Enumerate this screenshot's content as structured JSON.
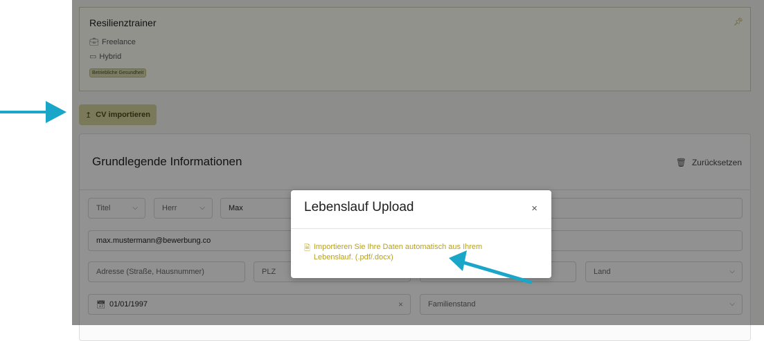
{
  "job": {
    "title": "Resilienztrainer",
    "employment_type": "Freelance",
    "work_mode": "Hybrid",
    "tag": "Betriebliche Gesundheit"
  },
  "cv_button": {
    "label": "CV importieren"
  },
  "form": {
    "title": "Grundlegende Informationen",
    "reset_label": "Zurücksetzen",
    "title_select": "Titel",
    "salutation_select": "Herr",
    "first_name": "Max",
    "email": "max.mustermann@bewerbung.co",
    "address_placeholder": "Adresse (Straße, Hausnummer)",
    "zip_placeholder": "PLZ",
    "country_placeholder": "Land",
    "birthdate": "01/01/1997",
    "marital_status_placeholder": "Familienstand"
  },
  "modal": {
    "title": "Lebenslauf Upload",
    "close_label": "×",
    "import_text": "Importieren Sie Ihre Daten automatisch aus Ihrem Lebenslauf. (.pdf/.docx)"
  },
  "colors": {
    "accent": "#b4a028",
    "cv_button_bg": "#d3d09a",
    "annotation_arrow": "#1aa6c8"
  }
}
